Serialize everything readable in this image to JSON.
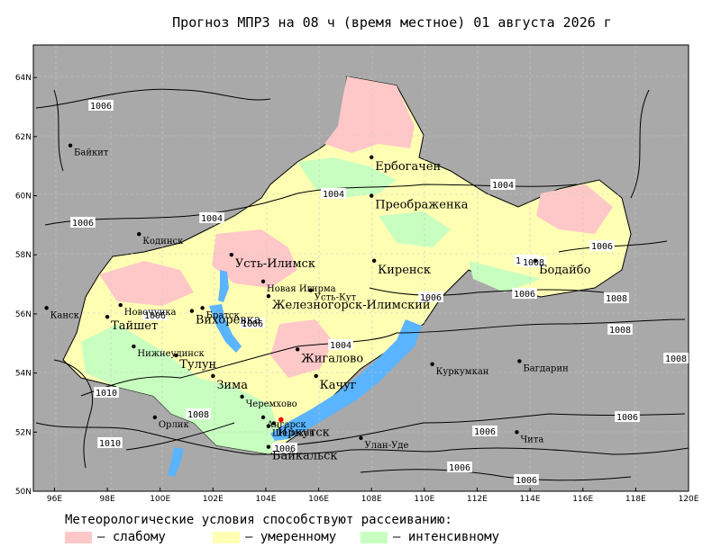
{
  "title": "Прогноз МПРЗ на 08 ч (время местное) 01 августа 2026 г",
  "colors": {
    "background_land": "#a9a9a9",
    "water": "#5ab4ff",
    "weak": "#ffc8c8",
    "moderate": "#ffffb4",
    "intensive": "#c8ffc0"
  },
  "axes": {
    "lat_labels": [
      "64N",
      "62N",
      "60N",
      "58N",
      "56N",
      "54N",
      "52N",
      "50N"
    ],
    "lon_labels": [
      "96E",
      "98E",
      "100E",
      "102E",
      "104E",
      "106E",
      "108E",
      "110E",
      "112E",
      "114E",
      "116E",
      "118E",
      "120E"
    ]
  },
  "cities": [
    {
      "name": "Байкит",
      "lon": 96.6,
      "lat": 61.7,
      "size": "small"
    },
    {
      "name": "Ербогачен",
      "lon": 108.0,
      "lat": 61.3,
      "size": "big"
    },
    {
      "name": "Преображенка",
      "lon": 108.0,
      "lat": 60.0,
      "size": "big"
    },
    {
      "name": "Кодинск",
      "lon": 99.2,
      "lat": 58.7,
      "size": "small"
    },
    {
      "name": "Усть-Илимск",
      "lon": 102.7,
      "lat": 58.0,
      "size": "big"
    },
    {
      "name": "Новая Игирма",
      "lon": 103.9,
      "lat": 57.1,
      "size": "small"
    },
    {
      "name": "Киренск",
      "lon": 108.1,
      "lat": 57.8,
      "size": "big"
    },
    {
      "name": "Бодайбо",
      "lon": 114.2,
      "lat": 57.8,
      "size": "big"
    },
    {
      "name": "Усть-Кут",
      "lon": 105.7,
      "lat": 56.8,
      "size": "small"
    },
    {
      "name": "Железногорск-Илимский",
      "lon": 104.1,
      "lat": 56.6,
      "size": "big"
    },
    {
      "name": "Братск",
      "lon": 101.6,
      "lat": 56.2,
      "size": "small"
    },
    {
      "name": "Канск",
      "lon": 95.7,
      "lat": 56.2,
      "size": "small"
    },
    {
      "name": "Новочунка",
      "lon": 98.5,
      "lat": 56.3,
      "size": "small"
    },
    {
      "name": "Тайшет",
      "lon": 98.0,
      "lat": 55.9,
      "size": "big"
    },
    {
      "name": "Вихоревка",
      "lon": 101.2,
      "lat": 56.1,
      "size": "big"
    },
    {
      "name": "Нижнеудинск",
      "lon": 99.0,
      "lat": 54.9,
      "size": "small"
    },
    {
      "name": "Жигалово",
      "lon": 105.2,
      "lat": 54.8,
      "size": "big"
    },
    {
      "name": "Тулун",
      "lon": 100.6,
      "lat": 54.6,
      "size": "big"
    },
    {
      "name": "Куркумкан",
      "lon": 110.3,
      "lat": 54.3,
      "size": "small"
    },
    {
      "name": "Багдарин",
      "lon": 113.6,
      "lat": 54.4,
      "size": "small"
    },
    {
      "name": "Зима",
      "lon": 102.0,
      "lat": 53.9,
      "size": "big"
    },
    {
      "name": "Качуг",
      "lon": 105.9,
      "lat": 53.9,
      "size": "big"
    },
    {
      "name": "Черемхово",
      "lon": 103.1,
      "lat": 53.2,
      "size": "small"
    },
    {
      "name": "Орлик",
      "lon": 99.8,
      "lat": 52.5,
      "size": "small"
    },
    {
      "name": "Ангарск",
      "lon": 103.9,
      "lat": 52.5,
      "size": "small"
    },
    {
      "name": "Шелехов",
      "lon": 104.1,
      "lat": 52.2,
      "size": "small"
    },
    {
      "name": "Иркутск",
      "lon": 104.3,
      "lat": 52.3,
      "size": "big"
    },
    {
      "name": "Улан-Уде",
      "lon": 107.6,
      "lat": 51.8,
      "size": "small"
    },
    {
      "name": "Чита",
      "lon": 113.5,
      "lat": 52.0,
      "size": "small"
    },
    {
      "name": "Байкальск",
      "lon": 104.1,
      "lat": 51.5,
      "size": "big"
    }
  ],
  "isobar_labels": [
    "1006",
    "1004",
    "1004",
    "1004",
    "1006",
    "1006",
    "1004",
    "1006",
    "1004",
    "1006",
    "1006",
    "1008",
    "1008",
    "1008",
    "1010",
    "1008",
    "1010",
    "1006",
    "1006",
    "1006",
    "1006",
    "1006",
    "1008",
    "1006"
  ],
  "legend": {
    "title": "Метеорологические условия способствуют рассеиванию:",
    "items": [
      {
        "label": "— слабому",
        "color": "#ffc8c8"
      },
      {
        "label": "— умеренному",
        "color": "#ffffb4"
      },
      {
        "label": "— интенсивному",
        "color": "#c8ffc0"
      }
    ]
  }
}
